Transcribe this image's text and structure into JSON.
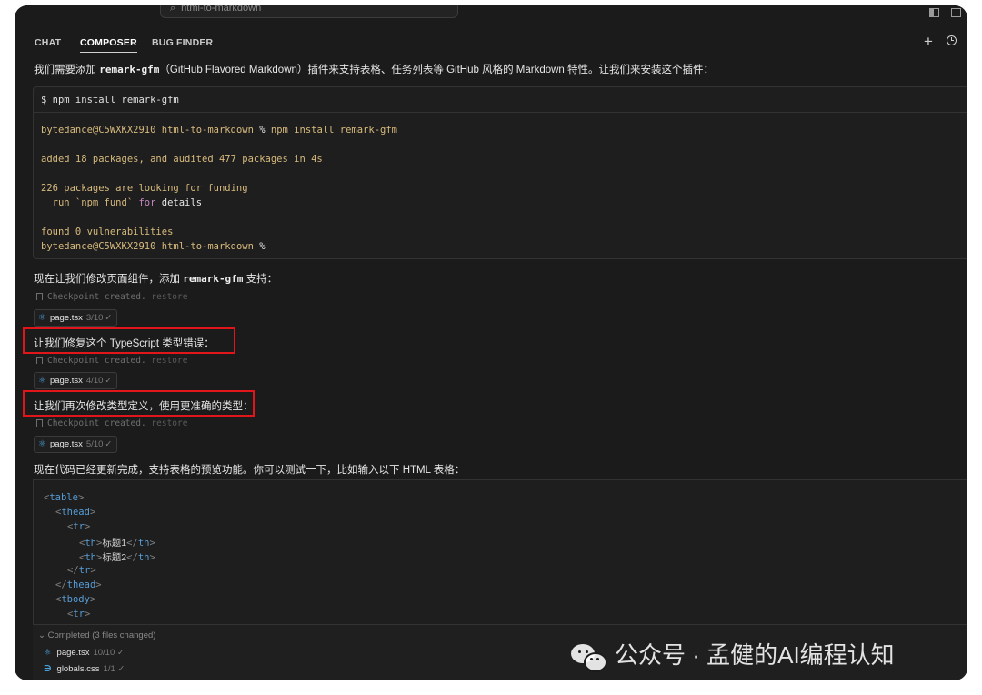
{
  "search": {
    "value": "html-to-markdown"
  },
  "tabs": [
    {
      "label": "CHAT",
      "active": false
    },
    {
      "label": "COMPOSER",
      "active": true
    },
    {
      "label": "BUG FINDER",
      "active": false
    }
  ],
  "messages": {
    "m1_pre": "我们需要添加 ",
    "m1_code": "remark-gfm",
    "m1_post": "（GitHub Flavored Markdown）插件来支持表格、任务列表等 GitHub 风格的 Markdown 特性。让我们来安装这个插件：",
    "m2_pre": "现在让我们修改页面组件，添加 ",
    "m2_code": "remark-gfm",
    "m2_post": " 支持：",
    "m3": "让我们修复这个 TypeScript 类型错误：",
    "m4": "让我们再次修改类型定义，使用更准确的类型：",
    "m5": "现在代码已经更新完成，支持表格的预览功能。你可以测试一下，比如输入以下 HTML 表格："
  },
  "terminal": {
    "command": "$ npm install remark-gfm",
    "line1_prompt": "bytedance@C5WXKX2910",
    "line1_dir": "html-to-markdown",
    "line1_sym": "%",
    "line1_cmd": "npm install remark-gfm",
    "line2": "added 18 packages, and audited 477 packages in 4s",
    "line3": "226 packages are looking for funding",
    "line4_a": "  run `npm fund` ",
    "line4_b": "for",
    "line4_c": " details",
    "line5": "found 0 vulnerabilities",
    "line6_prompt": "bytedance@C5WXKX2910",
    "line6_dir": "html-to-markdown",
    "line6_sym": "%"
  },
  "checkpoint": {
    "text": "Checkpoint created.",
    "restore": "restore"
  },
  "file_chips": [
    {
      "name": "page.tsx",
      "count": "3/10",
      "check": "✓"
    },
    {
      "name": "page.tsx",
      "count": "4/10",
      "check": "✓"
    },
    {
      "name": "page.tsx",
      "count": "5/10",
      "check": "✓"
    }
  ],
  "code": {
    "l1": "table",
    "l2": "thead",
    "l3": "tr",
    "h1": "标题1",
    "h2": "标题2",
    "th": "th",
    "l4": "tr",
    "l5": "thead",
    "l6": "tbody",
    "l7": "tr"
  },
  "completed": {
    "header": "Completed (3 files changed)",
    "files": [
      {
        "name": "page.tsx",
        "count": "10/10 ✓"
      },
      {
        "name": "globals.css",
        "count": "1/1 ✓"
      }
    ]
  },
  "watermark": {
    "text": "公众号 · 孟健的AI编程认知"
  },
  "colors": {
    "highlight_box": "#e0161b",
    "react_icon": "#4aa3df",
    "tag": "#569cd6"
  }
}
